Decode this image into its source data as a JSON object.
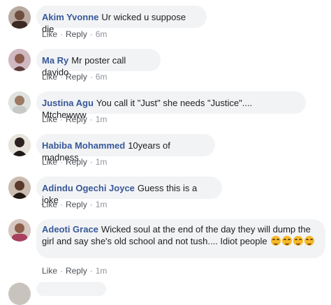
{
  "actions": {
    "like": "Like",
    "reply": "Reply",
    "separator": "·"
  },
  "comments": [
    {
      "author": "Akim Yvonne",
      "text": "Ur wicked u suppose die",
      "time": "6m"
    },
    {
      "author": "Ma Ry",
      "text": "Mr poster call davido",
      "time": "6m"
    },
    {
      "author": "Justina Agu",
      "text": "You call it \"Just\" she needs \"Justice\".... Mtchewww",
      "time": "1m"
    },
    {
      "author": "Habiba Mohammed",
      "text": "10years of madness",
      "time": "1m"
    },
    {
      "author": "Adindu Ogechi Joyce",
      "text": "Guess this is a joke",
      "time": "1m"
    },
    {
      "author": "Adeoti Grace",
      "text": "Wicked soul at the end of the day they will dump the girl and say she's old school and not tush.... Idiot people",
      "emoji": "smiling-face-icon",
      "time": "1m"
    }
  ]
}
